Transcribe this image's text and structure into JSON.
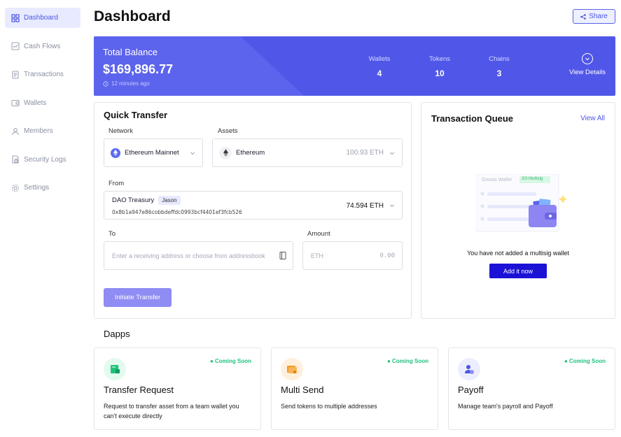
{
  "sidebar": {
    "items": [
      {
        "label": "Dashboard",
        "icon": "grid-icon",
        "active": true
      },
      {
        "label": "Cash Flows",
        "icon": "chart-icon"
      },
      {
        "label": "Transactions",
        "icon": "document-icon"
      },
      {
        "label": "Wallets",
        "icon": "wallet-icon"
      },
      {
        "label": "Members",
        "icon": "user-icon"
      },
      {
        "label": "Security Logs",
        "icon": "file-lock-icon"
      },
      {
        "label": "Settings",
        "icon": "gear-icon"
      }
    ]
  },
  "header": {
    "title": "Dashboard",
    "share_label": "Share"
  },
  "balance": {
    "label": "Total Balance",
    "amount": "$169,896.77",
    "updated": "12 minutes ago",
    "stats": [
      {
        "label": "Wallets",
        "value": "4"
      },
      {
        "label": "Tokens",
        "value": "10"
      },
      {
        "label": "Chains",
        "value": "3"
      }
    ],
    "view_details": "View Details"
  },
  "quick_transfer": {
    "title": "Quick Transfer",
    "network_label": "Network",
    "network_value": "Ethereum Mainnet",
    "assets_label": "Assets",
    "asset_name": "Ethereum",
    "asset_balance": "100.93 ETH",
    "from_label": "From",
    "from_name": "DAO Treasury",
    "from_tag": "Jason",
    "from_address": "0x8b1a947e86cobbdeffdc0993bcf4401ef3fcb526",
    "from_balance": "74.594 ETH",
    "to_label": "To",
    "to_placeholder": "Enter a receiving address or choose from addressbook",
    "amount_label": "Amount",
    "amount_unit": "ETH",
    "amount_placeholder": "0.00",
    "submit_label": "Initiate Transfer"
  },
  "transaction_queue": {
    "title": "Transaction Queue",
    "view_all": "View All",
    "illustration_wallet": "Gnosis Wallet",
    "illustration_badge": "3/3 Multisig",
    "empty_message": "You have not added a multisig wallet",
    "add_label": "Add it now"
  },
  "dapps": {
    "title": "Dapps",
    "items": [
      {
        "name": "Transfer Request",
        "status": "Coming Soon",
        "description": "Request to transfer asset from a team wallet you can't execute directly",
        "icon": "transfer-request-icon",
        "color": "#1fc27a"
      },
      {
        "name": "Multi Send",
        "status": "Coming Soon",
        "description": "Send tokens to multiple addresses",
        "icon": "multi-send-icon",
        "color": "#f29a1f"
      },
      {
        "name": "Payoff",
        "status": "Coming Soon",
        "description": "Manage team's payroll and Payoff",
        "icon": "payoff-icon",
        "color": "#4a55e0"
      }
    ]
  },
  "colors": {
    "accent": "#4a55e0",
    "banner": "#5057e8",
    "button": "#8f8cf3",
    "success": "#1fc27a"
  }
}
